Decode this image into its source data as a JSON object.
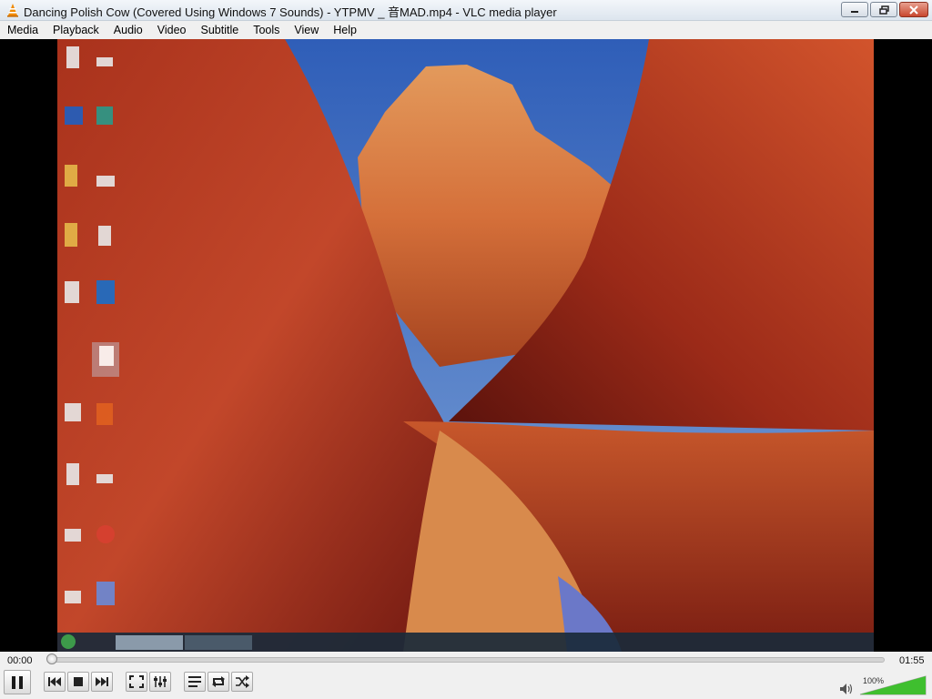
{
  "window": {
    "title": "Dancing Polish Cow (Covered Using Windows 7 Sounds) - YTPMV _ 音MAD.mp4 - VLC media player"
  },
  "menu": [
    "Media",
    "Playback",
    "Audio",
    "Video",
    "Subtitle",
    "Tools",
    "View",
    "Help"
  ],
  "player": {
    "elapsed": "00:00",
    "total": "01:55",
    "progress": 0.0,
    "volume_label": "100%",
    "volume": 1.0
  },
  "colors": {
    "vlc_orange": "#f08a00",
    "volume_green": "#3fbf2f",
    "close_red": "#c8472f"
  },
  "icons": [
    "vlc-cone-icon",
    "minimize-icon",
    "restore-icon",
    "close-icon",
    "pause-icon",
    "previous-icon",
    "stop-icon",
    "next-icon",
    "fullscreen-icon",
    "extended-settings-icon",
    "playlist-icon",
    "loop-icon",
    "shuffle-icon",
    "speaker-icon"
  ]
}
